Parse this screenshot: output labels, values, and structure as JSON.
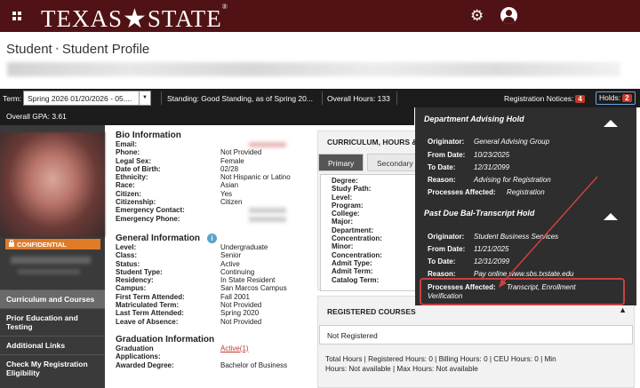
{
  "brand": {
    "logo_text": "TEXAS",
    "logo_star": "★",
    "logo_text2": "STATE",
    "logo_reg": "®"
  },
  "header": {
    "title_part1": "Student",
    "separator": "•",
    "title_part2": "Student Profile"
  },
  "termbar": {
    "term_label": "Term:",
    "term_value": "Spring 2026 01/20/2026 - 05....",
    "standing": "Standing: Good Standing, as of Spring 20...",
    "overall_hours": "Overall Hours: 133",
    "notices_label": "Registration Notices:",
    "notices_count": "4",
    "holds_label": "Holds:",
    "holds_count": "2",
    "gpa": "Overall GPA: 3.61"
  },
  "sidebar": {
    "confidential": "CONFIDENTIAL",
    "items": [
      {
        "label": "Curriculum and Courses"
      },
      {
        "label": "Prior Education and Testing"
      },
      {
        "label": "Additional Links"
      },
      {
        "label": "Check My Registration Eligibility"
      }
    ]
  },
  "bio": {
    "title": "Bio Information",
    "rows": [
      {
        "k": "Email:",
        "v": ""
      },
      {
        "k": "Phone:",
        "v": "Not Provided"
      },
      {
        "k": "Legal Sex:",
        "v": "Female"
      },
      {
        "k": "Date of Birth:",
        "v": "02/28"
      },
      {
        "k": "Ethnicity:",
        "v": "Not Hispanic or Latino"
      },
      {
        "k": "Race:",
        "v": "Asian"
      },
      {
        "k": "Citizen:",
        "v": "Yes"
      },
      {
        "k": "Citizenship:",
        "v": "Citizen"
      },
      {
        "k": "Emergency Contact:",
        "v": ""
      },
      {
        "k": "Emergency Phone:",
        "v": ""
      }
    ]
  },
  "general": {
    "title": "General Information",
    "rows": [
      {
        "k": "Level:",
        "v": "Undergraduate"
      },
      {
        "k": "Class:",
        "v": "Senior"
      },
      {
        "k": "Status:",
        "v": "Active"
      },
      {
        "k": "Student Type:",
        "v": "Continuing"
      },
      {
        "k": "Residency:",
        "v": "In State Resident"
      },
      {
        "k": "Campus:",
        "v": "San Marcos Campus"
      },
      {
        "k": "First Term Attended:",
        "v": "Fall 2001"
      },
      {
        "k": "Matriculated Term:",
        "v": "Not Provided"
      },
      {
        "k": "Last Term Attended:",
        "v": "Spring 2020"
      },
      {
        "k": "Leave of Absence:",
        "v": "Not Provided"
      }
    ]
  },
  "graduation": {
    "title": "Graduation Information",
    "row1_k": "Graduation",
    "row1_v": "Active(1)",
    "row2_k": "Applications:",
    "row3_k": "Awarded Degree:",
    "row3_v": "Bachelor of Business"
  },
  "curriculum": {
    "title": "CURRICULUM, HOURS &",
    "tab_primary": "Primary",
    "tab_secondary": "Secondary",
    "fields": [
      "Degree:",
      "Study Path:",
      "Level:",
      "Program:",
      "College:",
      "Major:",
      "Department:",
      "Concentration:",
      "Minor:",
      "Concentration:",
      "Admit Type:",
      "Admit Term:",
      "Catalog Term:"
    ]
  },
  "registered": {
    "title": "REGISTERED COURSES",
    "status": "Not Registered",
    "totals_line1": "Total Hours |  Registered Hours:  0  |  Billing Hours:  0  |  CEU Hours:  0  |  Min",
    "totals_line2": "Hours:  Not available  |  Max Hours:  Not available"
  },
  "holds": [
    {
      "title": "Department Advising Hold",
      "originator_k": "Originator:",
      "originator": "General Advising Group",
      "from_k": "From Date:",
      "from": "10/23/2025",
      "to_k": "To Date:",
      "to": "12/31/2099",
      "reason_k": "Reason:",
      "reason": "Advising for Registration",
      "processes_k": "Processes Affected:",
      "processes": "Registration"
    },
    {
      "title": "Past Due Bal-Transcript Hold",
      "originator_k": "Originator:",
      "originator": "Student Business Services",
      "from_k": "From Date:",
      "from": "11/21/2025",
      "to_k": "To Date:",
      "to": "12/31/2099",
      "reason_k": "Reason:",
      "reason": "Pay online www.sbs.txstate.edu",
      "processes_k": "Processes Affected:",
      "processes": "Transcript, Enrollment",
      "processes2": "Verification"
    }
  ],
  "colors": {
    "maroon": "#501214",
    "dark": "#1c1c1c",
    "accent_orange": "#e07b28",
    "badge_red": "#c0392b",
    "highlight_red": "#c94040"
  },
  "icons": [
    "grid-icon",
    "gear-icon",
    "user-icon",
    "lock-icon",
    "info-icon",
    "chevron-down-icon",
    "chevron-up-icon"
  ]
}
